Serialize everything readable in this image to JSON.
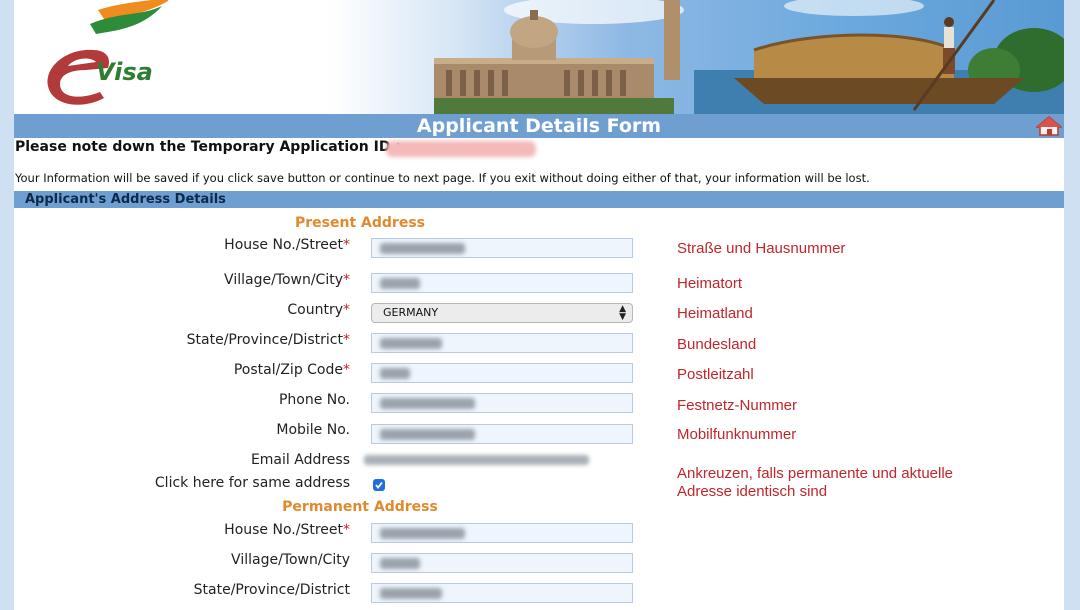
{
  "header": {
    "logo_text": "Visa",
    "logo_letter": "e",
    "title": "Applicant Details Form"
  },
  "notice": {
    "app_id_label": "Please note down the Temporary Application ID :",
    "info": "Your Information will be saved if you click save button or continue to next page. If you exit without doing either of that, your information will be lost."
  },
  "section": {
    "title": "Applicant's Address Details"
  },
  "present_address": {
    "heading": "Present Address",
    "house_label": "House No./Street",
    "village_label": "Village/Town/City",
    "country_label": "Country",
    "country_value": "GERMANY",
    "state_label": "State/Province/District",
    "postal_label": "Postal/Zip Code",
    "phone_label": "Phone No.",
    "mobile_label": "Mobile No.",
    "email_label": "Email Address",
    "same_address_label": "Click here for same address",
    "required_mark": "*"
  },
  "permanent_address": {
    "heading": "Permanent Address",
    "house_label": "House No./Street",
    "village_label": "Village/Town/City",
    "state_label": "State/Province/District"
  },
  "notes": {
    "house": "Straße und Hausnummer",
    "village": "Heimatort",
    "country": "Heimatland",
    "state": "Bundesland",
    "postal": "Postleitzahl",
    "phone": "Festnetz-Nummer",
    "mobile": "Mobilfunknummer",
    "same_line1": "Ankreuzen, falls permanente und aktuelle",
    "same_line2": "Adresse identisch sind"
  },
  "colors": {
    "accent": "#6f9fd0",
    "heading_orange": "#e08a2e",
    "note_red": "#c0262b",
    "page_bg": "#cfe0f3"
  },
  "icons": [
    "home-icon",
    "checkbox-checked-icon"
  ]
}
